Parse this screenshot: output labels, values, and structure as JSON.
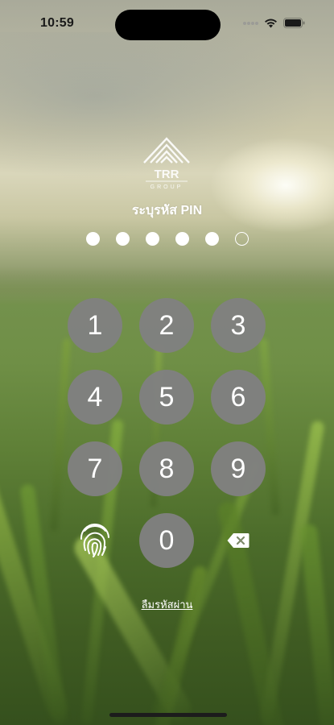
{
  "status_bar": {
    "time": "10:59",
    "icons": [
      "signal-dots-icon",
      "wifi-icon",
      "battery-icon"
    ]
  },
  "logo": {
    "icon": "trr-group-logo-icon",
    "text_main": "TRR",
    "text_sub": "GROUP"
  },
  "pin": {
    "prompt": "ระบุรหัส PIN",
    "length": 6,
    "entered": 5
  },
  "keypad": {
    "keys": [
      "1",
      "2",
      "3",
      "4",
      "5",
      "6",
      "7",
      "8",
      "9",
      "0"
    ],
    "biometric_icon": "fingerprint-icon",
    "delete_icon": "backspace-icon"
  },
  "forgot_link": "ลืมรหัสผ่าน",
  "colors": {
    "key_background": "#808080",
    "key_text": "#ffffff",
    "dot": "#ffffff"
  }
}
